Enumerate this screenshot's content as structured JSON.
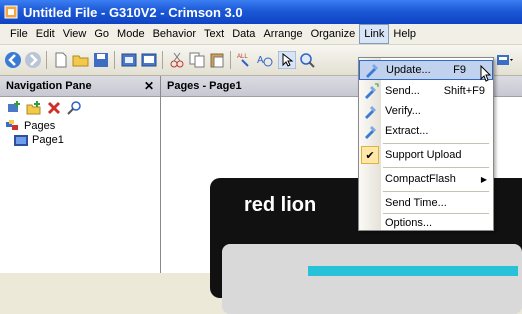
{
  "title": "Untitled File - G310V2 - Crimson 3.0",
  "menu": [
    {
      "label": "File"
    },
    {
      "label": "Edit"
    },
    {
      "label": "View"
    },
    {
      "label": "Go"
    },
    {
      "label": "Mode"
    },
    {
      "label": "Behavior"
    },
    {
      "label": "Text"
    },
    {
      "label": "Data"
    },
    {
      "label": "Arrange"
    },
    {
      "label": "Organize"
    },
    {
      "label": "Link"
    },
    {
      "label": "Help"
    }
  ],
  "nav": {
    "title": "Navigation Pane",
    "close": "✕",
    "tree_root": "Pages",
    "tree_child": "Page1"
  },
  "pages": {
    "title": "Pages - Page1",
    "logo": "red lion"
  },
  "link_menu": {
    "update": {
      "label": "Update...",
      "shortcut": "F9"
    },
    "send": {
      "label": "Send...",
      "shortcut": "Shift+F9"
    },
    "verify": {
      "label": "Verify..."
    },
    "extract": {
      "label": "Extract..."
    },
    "support_upload": {
      "label": "Support Upload"
    },
    "compact_flash": {
      "label": "CompactFlash"
    },
    "send_time": {
      "label": "Send Time..."
    },
    "options": {
      "label": "Options..."
    }
  },
  "colors": {
    "accent": "#316ac5",
    "title_bar": "#1c59d6",
    "device_cyan": "#29c1d8"
  }
}
